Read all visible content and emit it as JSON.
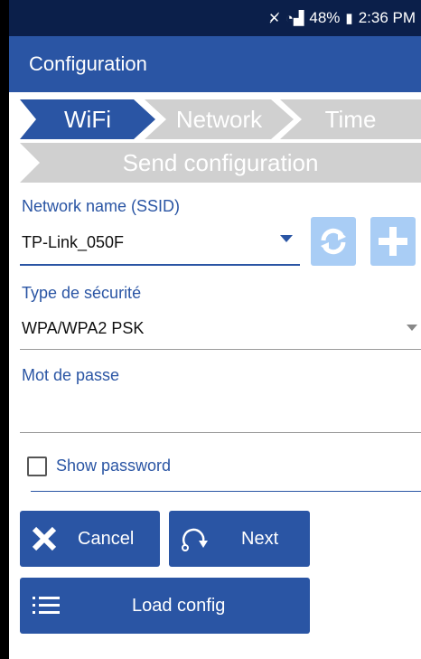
{
  "status_bar": {
    "battery": "48%",
    "time": "2:36 PM"
  },
  "appbar": {
    "title": "Configuration"
  },
  "steps": [
    "WiFi",
    "Network",
    "Time",
    "Send configuration"
  ],
  "ssid": {
    "label": "Network name (SSID)",
    "value": "TP-Link_050F"
  },
  "security": {
    "label": "Type de sécurité",
    "value": "WPA/WPA2 PSK"
  },
  "password": {
    "label": "Mot de passe",
    "value": ""
  },
  "show_password": {
    "label": "Show password",
    "checked": false
  },
  "buttons": {
    "cancel": "Cancel",
    "next": "Next",
    "load": "Load config"
  },
  "colors": {
    "primary": "#2a55a4",
    "disabled_btn": "#a9cdf5",
    "step_inactive": "#d0d0d0"
  }
}
